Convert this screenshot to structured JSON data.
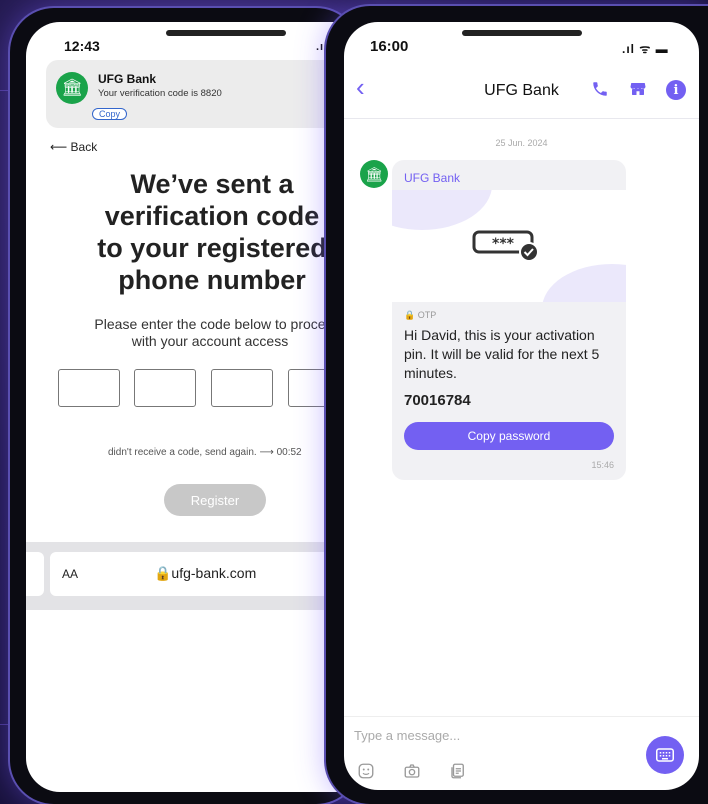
{
  "left_phone": {
    "status_time": "12:43",
    "notification": {
      "app_name": "UFG Bank",
      "message": "Your verification code is 8820",
      "copy_label": "Copy"
    },
    "back_label": "⟵ Back",
    "headline_lines": [
      "We’ve sent a",
      "verification code",
      "to your registered",
      "phone number"
    ],
    "subtitle_lines": [
      "Please enter the code below to proce",
      "with your account access"
    ],
    "resend_text": "didn't receive a code, send again. ⟶ 00:52",
    "register_label": "Register",
    "browser": {
      "aa_label": "AA",
      "url": "🔒ufg-bank.com"
    }
  },
  "right_phone": {
    "status_time": "16:00",
    "chat_title": "UFG Bank",
    "date": "25 Jun. 2024",
    "sender": "UFG Bank",
    "otp_label": "OTP",
    "message_text": "Hi David, this is your activation pin. It will be valid for the next 5 minutes.",
    "pin": "70016784",
    "copy_button_label": "Copy password",
    "message_time": "15:46",
    "input_placeholder": "Type a message..."
  },
  "icons": {
    "back_chevron": "chevron-left-icon",
    "call": "phone-icon",
    "shop": "store-icon",
    "info": "info-icon",
    "bank": "bank-icon",
    "sticker": "sticker-icon",
    "camera": "camera-icon",
    "gallery": "gallery-icon",
    "keyboard": "keyboard-icon"
  },
  "colors": {
    "accent": "#7360f2",
    "bank_green": "#1aa34a",
    "background": "#1e1648"
  }
}
